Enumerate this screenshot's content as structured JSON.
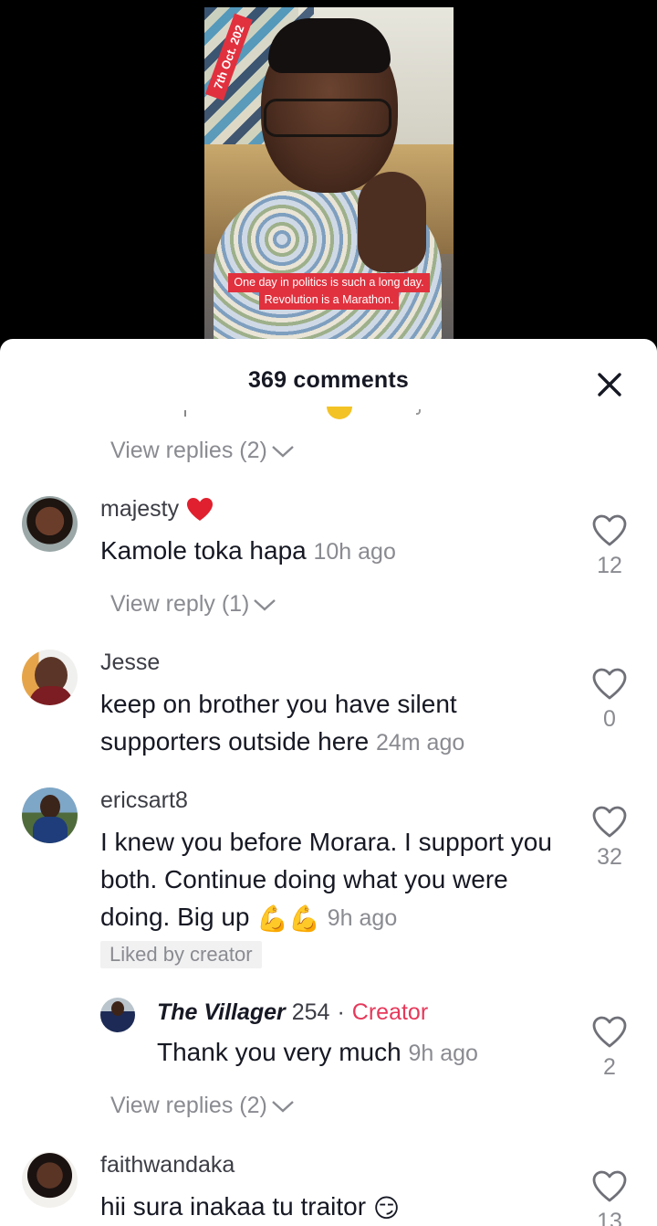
{
  "video": {
    "date_tag": "7th Oct. 202",
    "caption_line1": "One day in politics is such a long day.",
    "caption_line2": "Revolution is a Marathon."
  },
  "sheet": {
    "title": "369 comments"
  },
  "view_replies_top": {
    "label": "View replies (2)"
  },
  "comments": [
    {
      "username": "majesty",
      "has_heart_emoji": true,
      "text": "Kamole toka hapa",
      "ago": "10h ago",
      "likes": "12",
      "view_replies": "View reply (1)"
    },
    {
      "username": "Jesse",
      "text": "keep on brother you have silent supporters outside here",
      "ago": "24m ago",
      "likes": "0"
    },
    {
      "username": "ericsart8",
      "text": "I knew you before Morara. I support you both. Continue doing what you were doing. Big up",
      "emoji": "💪💪",
      "ago": "9h ago",
      "likes": "32",
      "liked_badge": "Liked by creator",
      "reply": {
        "username": "The Villager",
        "username_suffix": "254",
        "creator_label": "Creator",
        "separator": "·",
        "text": "Thank you very much",
        "ago": "9h ago",
        "likes": "2"
      },
      "view_replies": "View replies (2)"
    },
    {
      "username": "faithwandaka",
      "text": "hii sura inakaa tu traitor",
      "emoji": "😏",
      "likes": "13"
    }
  ],
  "colors": {
    "accent": "#e6385a",
    "caption_bg": "#e1313e",
    "muted": "#8a8b91"
  }
}
